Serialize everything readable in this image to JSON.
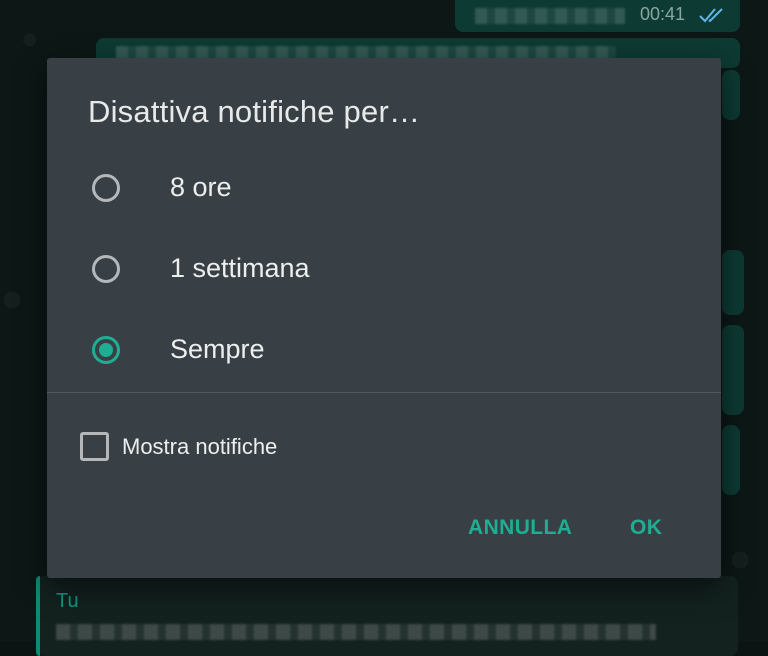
{
  "chat": {
    "last_message_time": "00:41",
    "quote_author": "Tu",
    "icons": {
      "read_receipt": "double-check-icon"
    }
  },
  "dialog": {
    "title": "Disattiva notifiche per…",
    "options": [
      {
        "label": "8 ore",
        "selected": false
      },
      {
        "label": "1 settimana",
        "selected": false
      },
      {
        "label": "Sempre",
        "selected": true
      }
    ],
    "show_notifications": {
      "label": "Mostra notifiche",
      "checked": false
    },
    "buttons": {
      "cancel_label": "ANNULLA",
      "ok_label": "OK"
    }
  },
  "colors": {
    "accent": "#1fae93",
    "dialog_background": "#394045",
    "text_primary": "#eceeee",
    "control_outline": "#b4b8ba"
  }
}
